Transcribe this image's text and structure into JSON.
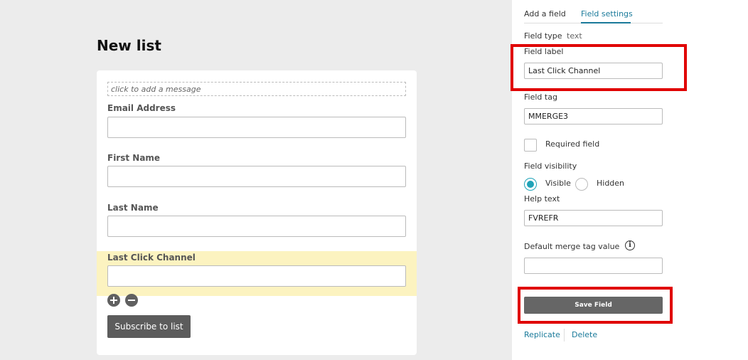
{
  "page": {
    "title": "New list"
  },
  "form": {
    "message_placeholder": "click to add a message",
    "fields": [
      {
        "label": "Email Address"
      },
      {
        "label": "First Name"
      },
      {
        "label": "Last Name"
      },
      {
        "label": "Last Click Channel"
      }
    ],
    "subscribe_label": "Subscribe to list"
  },
  "sidebar": {
    "tabs": [
      {
        "label": "Add a field",
        "active": false
      },
      {
        "label": "Field settings",
        "active": true
      }
    ],
    "field_type_label": "Field type",
    "field_type_value": "text",
    "field_label_label": "Field label",
    "field_label_value": "Last Click Channel",
    "field_tag_label": "Field tag",
    "field_tag_value": "MMERGE3",
    "required_label": "Required field",
    "visibility_label": "Field visibility",
    "visibility_options": [
      {
        "label": "Visible",
        "selected": true
      },
      {
        "label": "Hidden",
        "selected": false
      }
    ],
    "help_text_label": "Help text",
    "help_text_value": "FVREFR",
    "default_merge_label": "Default merge tag value",
    "default_merge_value": "",
    "info_glyph": "i",
    "save_label": "Save Field",
    "replicate_label": "Replicate",
    "delete_label": "Delete"
  },
  "colors": {
    "accent": "#1a7a9a",
    "radio_selected": "#20a3b8",
    "highlight": "#fcf3c0",
    "annotation_red": "#e00000"
  }
}
